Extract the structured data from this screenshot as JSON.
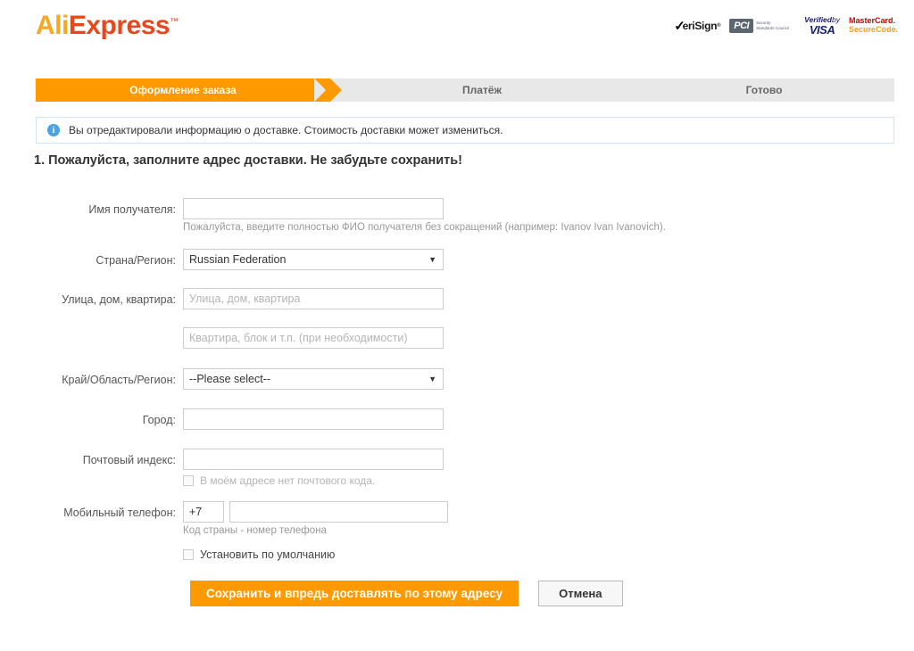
{
  "header": {
    "logo": {
      "part1": "Ali",
      "part2": "Express",
      "tm": "™"
    },
    "badges": [
      {
        "name": "verisign",
        "check": "✓",
        "text": "eriSign",
        "tm": "®"
      },
      {
        "name": "pci",
        "mark": "PCI",
        "line1": "Security",
        "line2": "Standards Council"
      },
      {
        "name": "verified-by-visa",
        "top_prefix": "Verified",
        "top_suffix": "by",
        "bottom": "VISA"
      },
      {
        "name": "mastercard-securecode",
        "top": "MasterCard.",
        "bottom": "SecureCode."
      }
    ]
  },
  "steps": [
    {
      "label": "Оформление заказа",
      "active": true
    },
    {
      "label": "Платёж",
      "active": false
    },
    {
      "label": "Готово",
      "active": false
    }
  ],
  "notice": {
    "icon": "info-icon",
    "icon_glyph": "i",
    "text": "Вы отредактировали информацию о доставке. Стоимость доставки может измениться."
  },
  "section": {
    "title": "1. Пожалуйста, заполните адрес доставки. Не забудьте сохранить!"
  },
  "form": {
    "recipient": {
      "label": "Имя получателя:",
      "value": "",
      "placeholder": "",
      "hint": "Пожалуйста, введите полностью ФИО получателя без сокращений (например: Ivanov Ivan Ivanovich)."
    },
    "country": {
      "label": "Страна/Регион:",
      "value": "Russian Federation",
      "options": [
        "Russian Federation"
      ],
      "arrow": "▼"
    },
    "street": {
      "label": "Улица, дом, квартира:",
      "value": "",
      "placeholder": "Улица, дом, квартира"
    },
    "street2": {
      "label": "",
      "value": "",
      "placeholder": "Квартира, блок и т.п. (при необходимости)"
    },
    "province": {
      "label": "Край/Область/Регион:",
      "value": "--Please select--",
      "options": [
        "--Please select--"
      ],
      "arrow": "▼"
    },
    "city": {
      "label": "Город:",
      "value": "",
      "placeholder": ""
    },
    "zip": {
      "label": "Почтовый индекс:",
      "value": "",
      "placeholder": "",
      "no_zip_checkbox_label": "В моём адресе нет почтового кода.",
      "no_zip_checked": false
    },
    "phone": {
      "label": "Мобильный телефон:",
      "code_value": "+7",
      "number_value": "",
      "hint": "Код страны - номер телефона"
    },
    "default_address": {
      "label": "Установить по умолчанию",
      "checked": false
    }
  },
  "buttons": {
    "save": "Сохранить и впредь доставлять по этому адресу",
    "cancel": "Отмена"
  },
  "colors": {
    "brand_orange": "#ff9900",
    "logo_orange": "#f7a823",
    "logo_red": "#e8471e",
    "step_inactive_bg": "#e8e8e8",
    "notice_border": "#cfe3f7",
    "info_blue": "#4aa3e8"
  }
}
